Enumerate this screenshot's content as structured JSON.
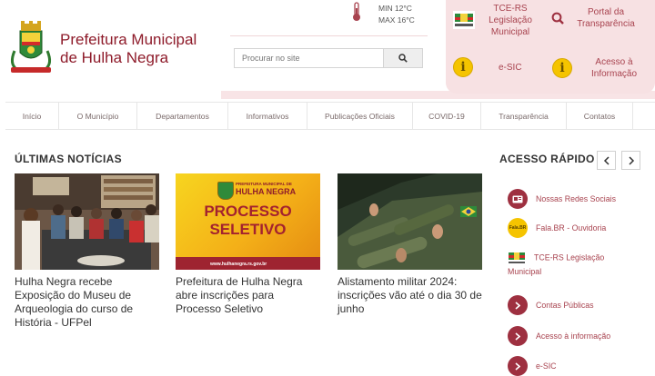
{
  "header": {
    "title_line1": "Prefeitura Municipal",
    "title_line2": "de Hulha Negra",
    "weather": {
      "min": "MIN 12°C",
      "max": "MAX 16°C"
    },
    "search": {
      "placeholder": "Procurar no site"
    }
  },
  "header_links": [
    {
      "label": "TCE-RS Legislação Municipal",
      "line1": "TCE-RS",
      "line2": "Legislação",
      "line3": "Municipal",
      "icon": "tce-rs-icon"
    },
    {
      "label": "Portal da Transparência",
      "line1": "Portal da",
      "line2": "Transparência",
      "icon": "search-icon"
    },
    {
      "label": "e-SIC",
      "icon": "info-icon"
    },
    {
      "label": "Acesso à Informação",
      "line1": "Acesso à",
      "line2": "Informação",
      "icon": "info-icon"
    }
  ],
  "nav": [
    "Início",
    "O Município",
    "Departamentos",
    "Informativos",
    "Publicações Oficiais",
    "COVID-19",
    "Transparência",
    "Contatos"
  ],
  "news": {
    "heading": "ÚLTIMAS NOTÍCIAS",
    "items": [
      {
        "title": "Hulha Negra recebe Exposição do Museu de Arqueologia do curso de História - UFPel"
      },
      {
        "title": "Prefeitura de Hulha Negra abre inscrições para Processo Seletivo",
        "image_text": {
          "brand_top": "PREFEITURA MUNICIPAL DE",
          "brand": "HULHA NEGRA",
          "line1": "PROCESSO",
          "line2": "SELETIVO",
          "url": "www.hulhanegra.rs.gov.br"
        }
      },
      {
        "title": "Alistamento militar 2024: inscrições vão até o dia 30 de junho"
      }
    ]
  },
  "quick_access": {
    "heading": "ACESSO RÁPIDO",
    "fala_badge": "Fala.BR",
    "items": [
      {
        "label": "Nossas Redes Sociais",
        "icon": "social-networks-icon"
      },
      {
        "label": "Fala.BR - Ouvidoria",
        "icon": "fala-br-icon"
      },
      {
        "label": "TCE-RS Legislação Municipal",
        "icon": "tce-rs-icon"
      },
      {
        "label": "Contas Públicas",
        "icon": "chevron-right-icon"
      },
      {
        "label": "Acesso à informação",
        "icon": "chevron-right-icon"
      },
      {
        "label": "e-SIC",
        "icon": "chevron-right-icon"
      }
    ]
  },
  "colors": {
    "brand": "#8e1b2a",
    "accent": "#a8434f",
    "panel": "#f7e1e3",
    "circle": "#9e3040"
  }
}
